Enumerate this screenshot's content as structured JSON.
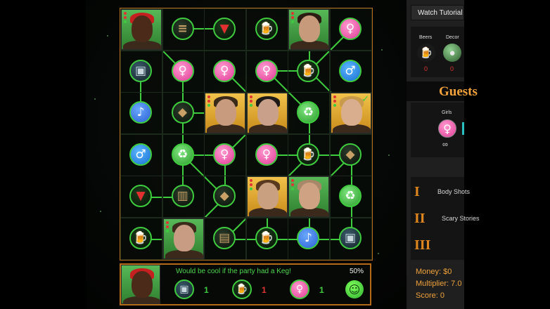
{
  "board": {
    "rows": [
      [
        {
          "kind": "portrait",
          "name": "portrait-dreadlocks-guy",
          "style": "green",
          "skin": "#4b2a1a",
          "hair": "#c52020",
          "dots": [
            "r",
            "r",
            "g"
          ]
        },
        {
          "kind": "token",
          "type": "dark",
          "icon": "plate-icon",
          "glyph": "≡"
        },
        {
          "kind": "token",
          "type": "cup",
          "icon": "red-cup-icon",
          "glyph": "▼"
        },
        {
          "kind": "token",
          "type": "beer",
          "icon": "beer-mug-icon",
          "glyph": "🍺"
        },
        {
          "kind": "portrait",
          "name": "portrait-smiling-guy",
          "style": "green",
          "skin": "#c79a7c",
          "hair": "#2b1d12",
          "dots": [
            "r",
            "r",
            "g"
          ]
        },
        {
          "kind": "token",
          "type": "female",
          "icon": "female-symbol-icon",
          "glyph": "♀"
        }
      ],
      [
        {
          "kind": "token",
          "type": "speaker",
          "icon": "speaker-icon",
          "glyph": "▣"
        },
        {
          "kind": "token",
          "type": "female",
          "icon": "female-symbol-icon",
          "glyph": "♀"
        },
        {
          "kind": "token",
          "type": "female",
          "icon": "female-symbol-icon",
          "glyph": "♀"
        },
        {
          "kind": "token",
          "type": "female",
          "icon": "female-symbol-icon",
          "glyph": "♀"
        },
        {
          "kind": "token",
          "type": "beer",
          "icon": "beer-mug-icon",
          "glyph": "🍺"
        },
        {
          "kind": "token",
          "type": "male",
          "icon": "male-symbol-icon",
          "glyph": "♂"
        }
      ],
      [
        {
          "kind": "token",
          "type": "music",
          "icon": "music-note-icon",
          "glyph": "♪"
        },
        {
          "kind": "token",
          "type": "dark",
          "icon": "food-icon",
          "glyph": "◆"
        },
        {
          "kind": "portrait",
          "name": "portrait-curly-guy",
          "style": "gold",
          "skin": "#c89a7e",
          "hair": "#3a2a1a",
          "dots": [
            "r",
            "r",
            "g"
          ]
        },
        {
          "kind": "portrait",
          "name": "portrait-dark-hair-guy",
          "style": "gold",
          "skin": "#c9a08a",
          "hair": "#1e1a18",
          "dots": [
            "r",
            "r",
            "g"
          ]
        },
        {
          "kind": "token",
          "type": "recycle",
          "icon": "recycle-icon",
          "glyph": "♻"
        },
        {
          "kind": "portrait",
          "name": "portrait-blond-guy",
          "style": "gold",
          "skin": "#d9ae8e",
          "hair": "#c89a4a",
          "dots": [
            "r",
            "r",
            "g"
          ],
          "check": true
        }
      ],
      [
        {
          "kind": "token",
          "type": "male",
          "icon": "male-symbol-icon",
          "glyph": "♂"
        },
        {
          "kind": "token",
          "type": "recycle",
          "icon": "recycle-icon",
          "glyph": "♻"
        },
        {
          "kind": "token",
          "type": "female",
          "icon": "female-symbol-icon",
          "glyph": "♀"
        },
        {
          "kind": "token",
          "type": "female",
          "icon": "female-symbol-icon",
          "glyph": "♀"
        },
        {
          "kind": "token",
          "type": "beer",
          "icon": "beer-mug-icon",
          "glyph": "🍺"
        },
        {
          "kind": "token",
          "type": "dark",
          "icon": "pizza-icon",
          "glyph": "◆"
        }
      ],
      [
        {
          "kind": "token",
          "type": "cup",
          "icon": "red-cup-icon",
          "glyph": "▼"
        },
        {
          "kind": "token",
          "type": "dark",
          "icon": "drinks-icon",
          "glyph": "▥"
        },
        {
          "kind": "token",
          "type": "dark",
          "icon": "pizza-icon",
          "glyph": "◆"
        },
        {
          "kind": "portrait",
          "name": "portrait-brown-hair-guy",
          "style": "gold",
          "skin": "#c9a080",
          "hair": "#5a3a1e",
          "dots": [
            "r",
            "r",
            "g"
          ]
        },
        {
          "kind": "portrait",
          "name": "portrait-bald-guy",
          "style": "green",
          "skin": "#d0a284",
          "hair": "#a88868",
          "dots": [
            "r",
            "r",
            "g"
          ]
        },
        {
          "kind": "token",
          "type": "recycle",
          "icon": "recycle-icon",
          "glyph": "♻"
        }
      ],
      [
        {
          "kind": "token",
          "type": "beer",
          "icon": "beer-mug-icon",
          "glyph": "🍺"
        },
        {
          "kind": "portrait",
          "name": "portrait-young-guy",
          "style": "green",
          "skin": "#c89c82",
          "hair": "#3a2a1c",
          "dots": [
            "r",
            "r",
            "g"
          ]
        },
        {
          "kind": "token",
          "type": "dark",
          "icon": "keg-icon",
          "glyph": "▤"
        },
        {
          "kind": "token",
          "type": "beer",
          "icon": "beer-mug-icon",
          "glyph": "🍺"
        },
        {
          "kind": "token",
          "type": "music",
          "icon": "music-note-icon",
          "glyph": "♪"
        },
        {
          "kind": "token",
          "type": "speaker",
          "icon": "speaker-icon",
          "glyph": "▣"
        }
      ]
    ]
  },
  "request": {
    "message": "Would be cool if the party had a Keg!",
    "percent": "50%",
    "items": [
      {
        "icon": "speaker-icon",
        "type": "speaker",
        "glyph": "▣",
        "count": "1",
        "color": "#3ecc3e"
      },
      {
        "icon": "beer-mug-icon",
        "type": "beer",
        "glyph": "🍺",
        "count": "1",
        "color": "#e03333"
      },
      {
        "icon": "female-symbol-icon",
        "type": "female",
        "glyph": "♀",
        "count": "1",
        "color": "#3ecc3e"
      }
    ],
    "mood_glyph": "☺"
  },
  "sidebar": {
    "tutorial_label": "Watch Tutorial",
    "resources": [
      {
        "label": "Beers",
        "value": "0",
        "glyph": "🍺"
      },
      {
        "label": "Decor",
        "value": "0",
        "glyph": "●"
      }
    ],
    "guests_title": "Guests",
    "girls_label": "Girls",
    "girls_glyph": "♀",
    "girls_value": "∞",
    "levels": [
      {
        "numeral": "I",
        "name": "Body Shots"
      },
      {
        "numeral": "II",
        "name": "Scary Stories"
      },
      {
        "numeral": "III",
        "name": ""
      }
    ],
    "money_label": "Money:",
    "money_value": "$0",
    "multiplier_label": "Multiplier:",
    "multiplier_value": "7.0",
    "score_label": "Score:",
    "score_value": "0"
  },
  "colors": {
    "board_border": "#b56a1a",
    "link_green": "#3ecc3e",
    "accent_orange": "#f2a23a"
  }
}
